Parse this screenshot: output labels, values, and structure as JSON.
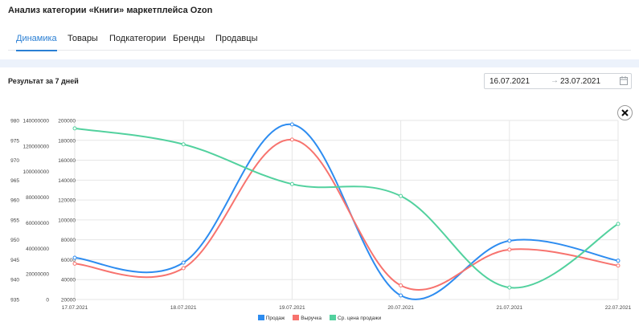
{
  "page": {
    "title": "Анализ категории «Книги» маркетплейса Ozon"
  },
  "tabs": [
    {
      "label": "Динамика",
      "active": true
    },
    {
      "label": "Товары",
      "active": false
    },
    {
      "label": "Подкатегории",
      "active": false
    },
    {
      "label": "Бренды",
      "active": false
    },
    {
      "label": "Продавцы",
      "active": false
    }
  ],
  "result": {
    "label": "Результат за 7 дней",
    "date_from": "16.07.2021",
    "date_to": "23.07.2021",
    "arrow": "→",
    "calendar_icon": "calendar-icon",
    "close_icon": "close-icon"
  },
  "chart_data": {
    "type": "line",
    "x": [
      "17.07.2021",
      "18.07.2021",
      "19.07.2021",
      "20.07.2021",
      "21.07.2021",
      "22.07.2021"
    ],
    "axes": [
      {
        "id": "price",
        "ticks": [
          "935",
          "940",
          "945",
          "950",
          "955",
          "960",
          "965",
          "970",
          "975",
          "980"
        ],
        "range": [
          935,
          980
        ]
      },
      {
        "id": "revenue",
        "ticks": [
          "0",
          "20000000",
          "40000000",
          "60000000",
          "80000000",
          "100000000",
          "120000000",
          "140000000"
        ],
        "range": [
          0,
          140000000
        ]
      },
      {
        "id": "sales",
        "ticks": [
          "20000",
          "40000",
          "60000",
          "80000",
          "100000",
          "120000",
          "140000",
          "160000",
          "180000",
          "200000"
        ],
        "range": [
          20000,
          200000
        ]
      }
    ],
    "series": [
      {
        "name": "Продаж",
        "axis": "sales",
        "color": "#2d8cf0",
        "values": [
          62000,
          57000,
          196000,
          24000,
          79000,
          59000
        ]
      },
      {
        "name": "Выручка",
        "axis": "revenue",
        "color": "#f7736e",
        "values": [
          28000000,
          24500000,
          125000000,
          11000000,
          39000000,
          26500000
        ]
      },
      {
        "name": "Ср. цена продажи",
        "axis": "price",
        "color": "#52d19e",
        "values": [
          978,
          974,
          964,
          961,
          938,
          954
        ]
      }
    ],
    "grid": true,
    "legend_position": "bottom"
  }
}
